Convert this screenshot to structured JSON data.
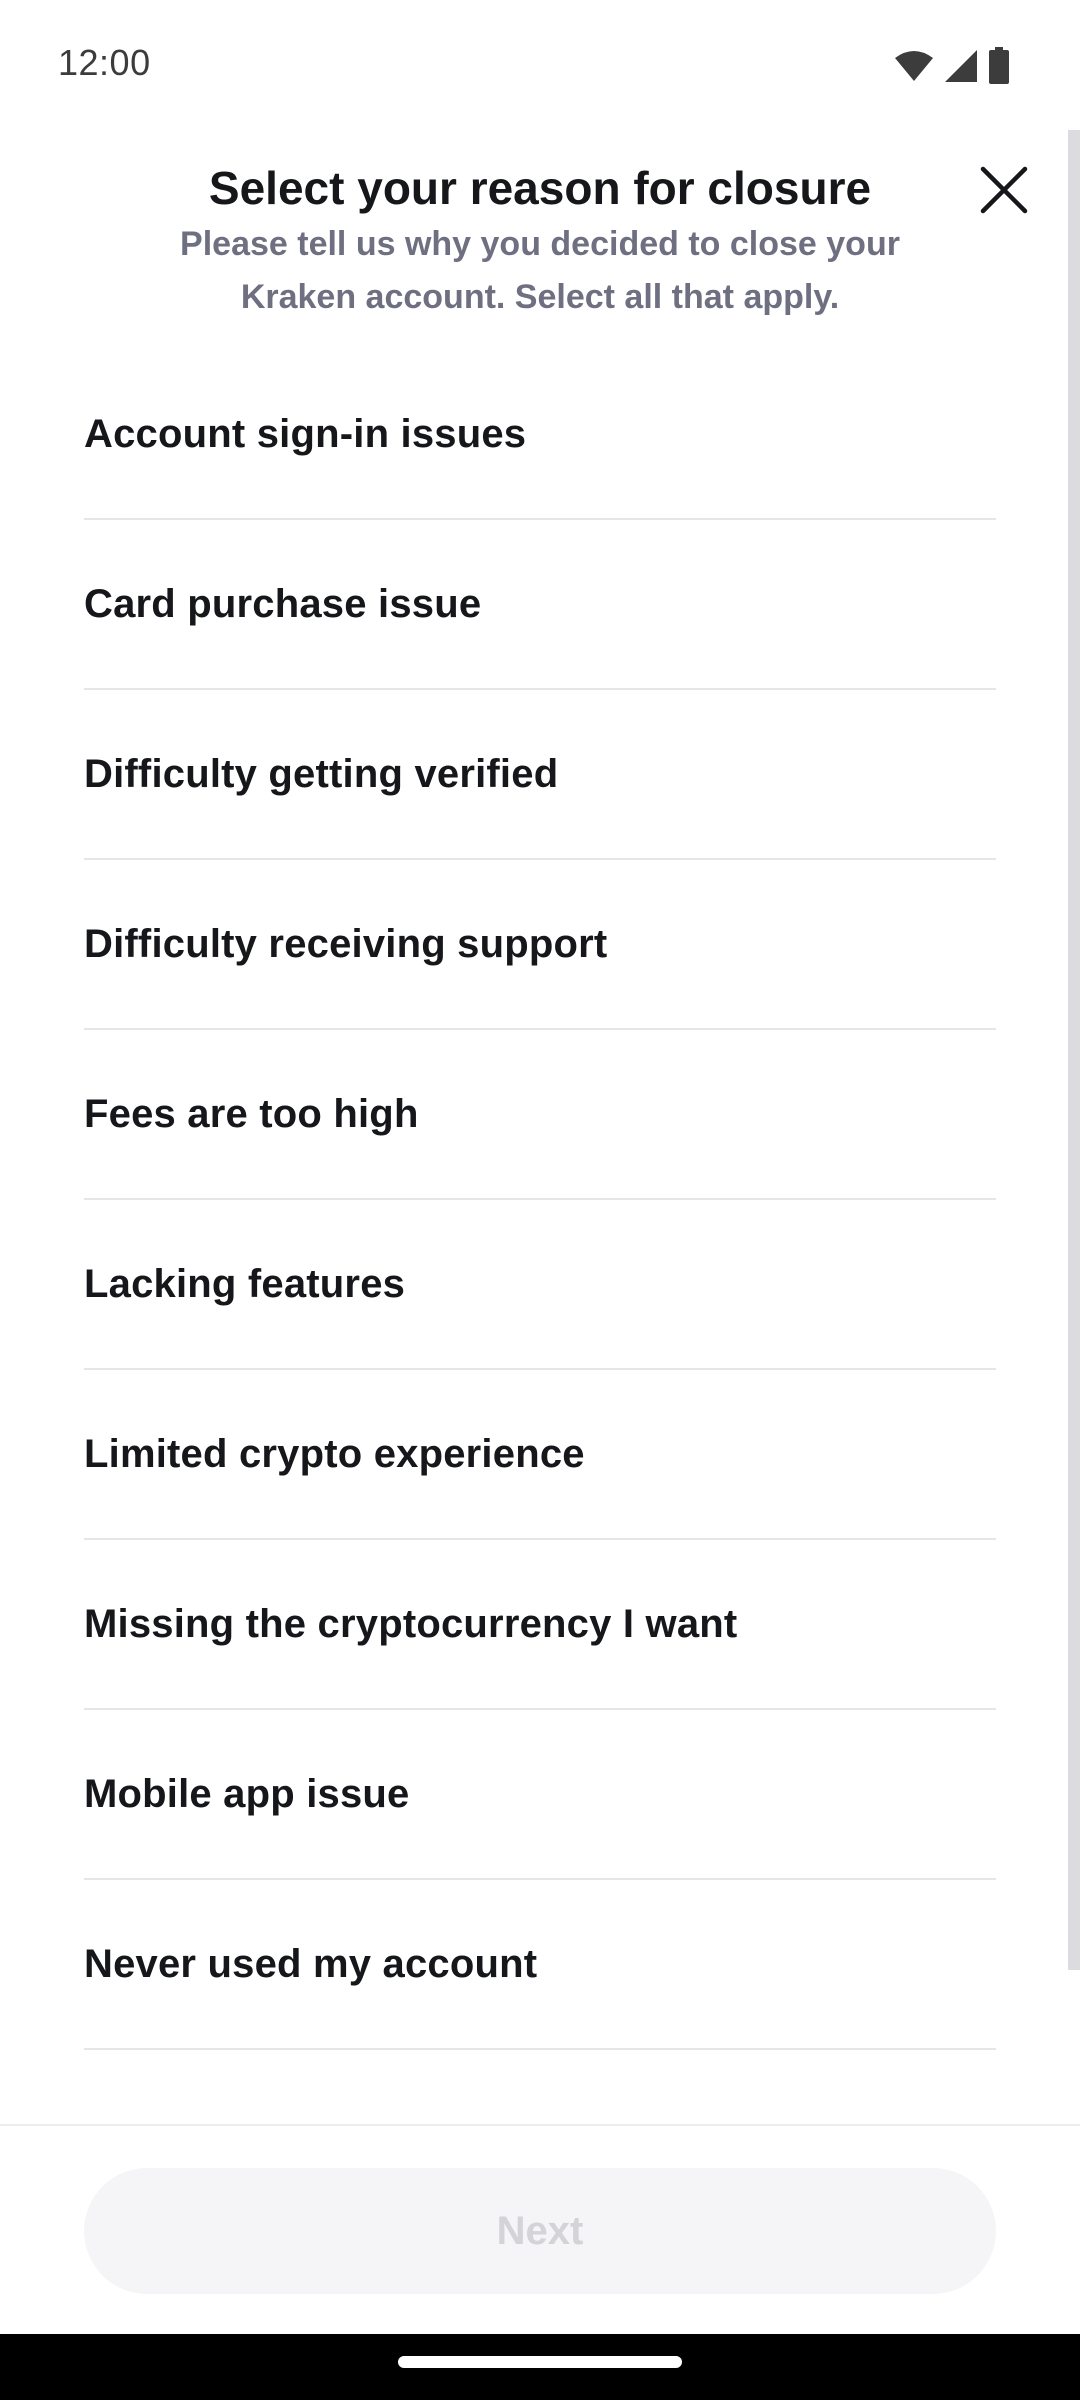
{
  "status_bar": {
    "time": "12:00",
    "icons": [
      "wifi-icon",
      "cellular-signal-icon",
      "battery-icon"
    ]
  },
  "header": {
    "title": "Select your reason for closure",
    "subtitle": "Please tell us why you decided to close your Kraken account. Select all that apply.",
    "close_icon": "close-icon"
  },
  "reasons": [
    {
      "label": "Account sign-in issues"
    },
    {
      "label": "Card purchase issue"
    },
    {
      "label": "Difficulty getting verified"
    },
    {
      "label": "Difficulty receiving support"
    },
    {
      "label": "Fees are too high"
    },
    {
      "label": "Lacking features"
    },
    {
      "label": "Limited crypto experience"
    },
    {
      "label": "Missing the cryptocurrency I want"
    },
    {
      "label": "Mobile app issue"
    },
    {
      "label": "Never used my account"
    }
  ],
  "footer": {
    "next_label": "Next",
    "next_enabled": false
  },
  "colors": {
    "title": "#16171b",
    "subtitle": "#6e7081",
    "divider": "#e6e6ea",
    "disabled_button_bg": "#f5f5f7",
    "disabled_button_text": "#d3d3d8"
  }
}
